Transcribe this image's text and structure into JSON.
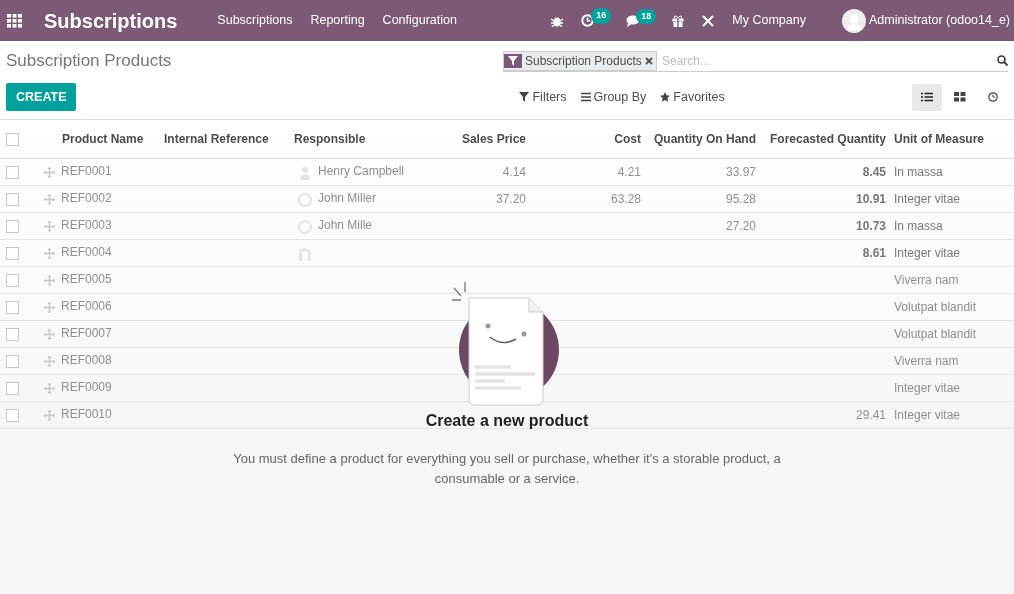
{
  "navbar": {
    "app_title": "Subscriptions",
    "menu": [
      "Subscriptions",
      "Reporting",
      "Configuration"
    ],
    "activity_count": "16",
    "message_count": "18",
    "company": "My Company",
    "user": "Administrator (odoo14_e)"
  },
  "control_panel": {
    "breadcrumb": "Subscription Products",
    "facet": "Subscription Products",
    "search_placeholder": "Search...",
    "create_label": "CREATE",
    "filters": [
      {
        "kind": "filter",
        "label": "Filters"
      },
      {
        "kind": "group",
        "label": "Group By"
      },
      {
        "kind": "favorite",
        "label": "Favorites"
      }
    ],
    "views": [
      {
        "kind": "list",
        "selected": true
      },
      {
        "kind": "kanban",
        "selected": false
      },
      {
        "kind": "activity",
        "selected": false
      }
    ]
  },
  "table": {
    "all_selected": false,
    "columns": [
      "Product Name",
      "Internal Reference",
      "Responsible",
      "Sales Price",
      "Cost",
      "Quantity On Hand",
      "Forecasted Quantity",
      "Unit of Measure"
    ],
    "rows": [
      {
        "checked": false,
        "product_name": "REF0001",
        "responsible": "Henry Campbell",
        "avatar": {
          "kind": "person"
        },
        "sales_price": "4.14",
        "cost": "4.21",
        "qty_on_hand": "33.97",
        "forecasted": "8.45",
        "uom": "In massa"
      },
      {
        "checked": false,
        "product_name": "REF0002",
        "responsible": "John Miller",
        "avatar": {
          "kind": "circle"
        },
        "sales_price": "37.20",
        "cost": "63.28",
        "qty_on_hand": "95.28",
        "forecasted": "10.91",
        "uom": "Integer vitae"
      },
      {
        "checked": false,
        "product_name": "REF0003",
        "responsible": "John Mille",
        "avatar": {
          "kind": "circle"
        },
        "qty_on_hand": "27.20",
        "forecasted": "10.73",
        "uom": "In massa"
      },
      {
        "checked": false,
        "product_name": "REF0004",
        "avatar": {
          "kind": "arch"
        },
        "forecasted": "8.61",
        "uom": "Integer vitae"
      },
      {
        "checked": false,
        "product_name": "REF0005",
        "uom": "Viverra nam"
      },
      {
        "checked": false,
        "product_name": "REF0006",
        "uom": "Volutpat blandit"
      },
      {
        "checked": false,
        "product_name": "REF0007",
        "uom": "Volutpat blandit"
      },
      {
        "checked": false,
        "product_name": "REF0008",
        "uom": "Viverra nam"
      },
      {
        "checked": false,
        "product_name": "REF0009",
        "uom": "Integer vitae"
      },
      {
        "checked": false,
        "product_name": "REF0010",
        "forecasted": "29.41",
        "uom": "Integer vitae"
      }
    ]
  },
  "empty_state": {
    "title": "Create a new product",
    "text": "You must define a product for everything you sell or purchase, whether it's a storable product, a consumable or a service."
  }
}
